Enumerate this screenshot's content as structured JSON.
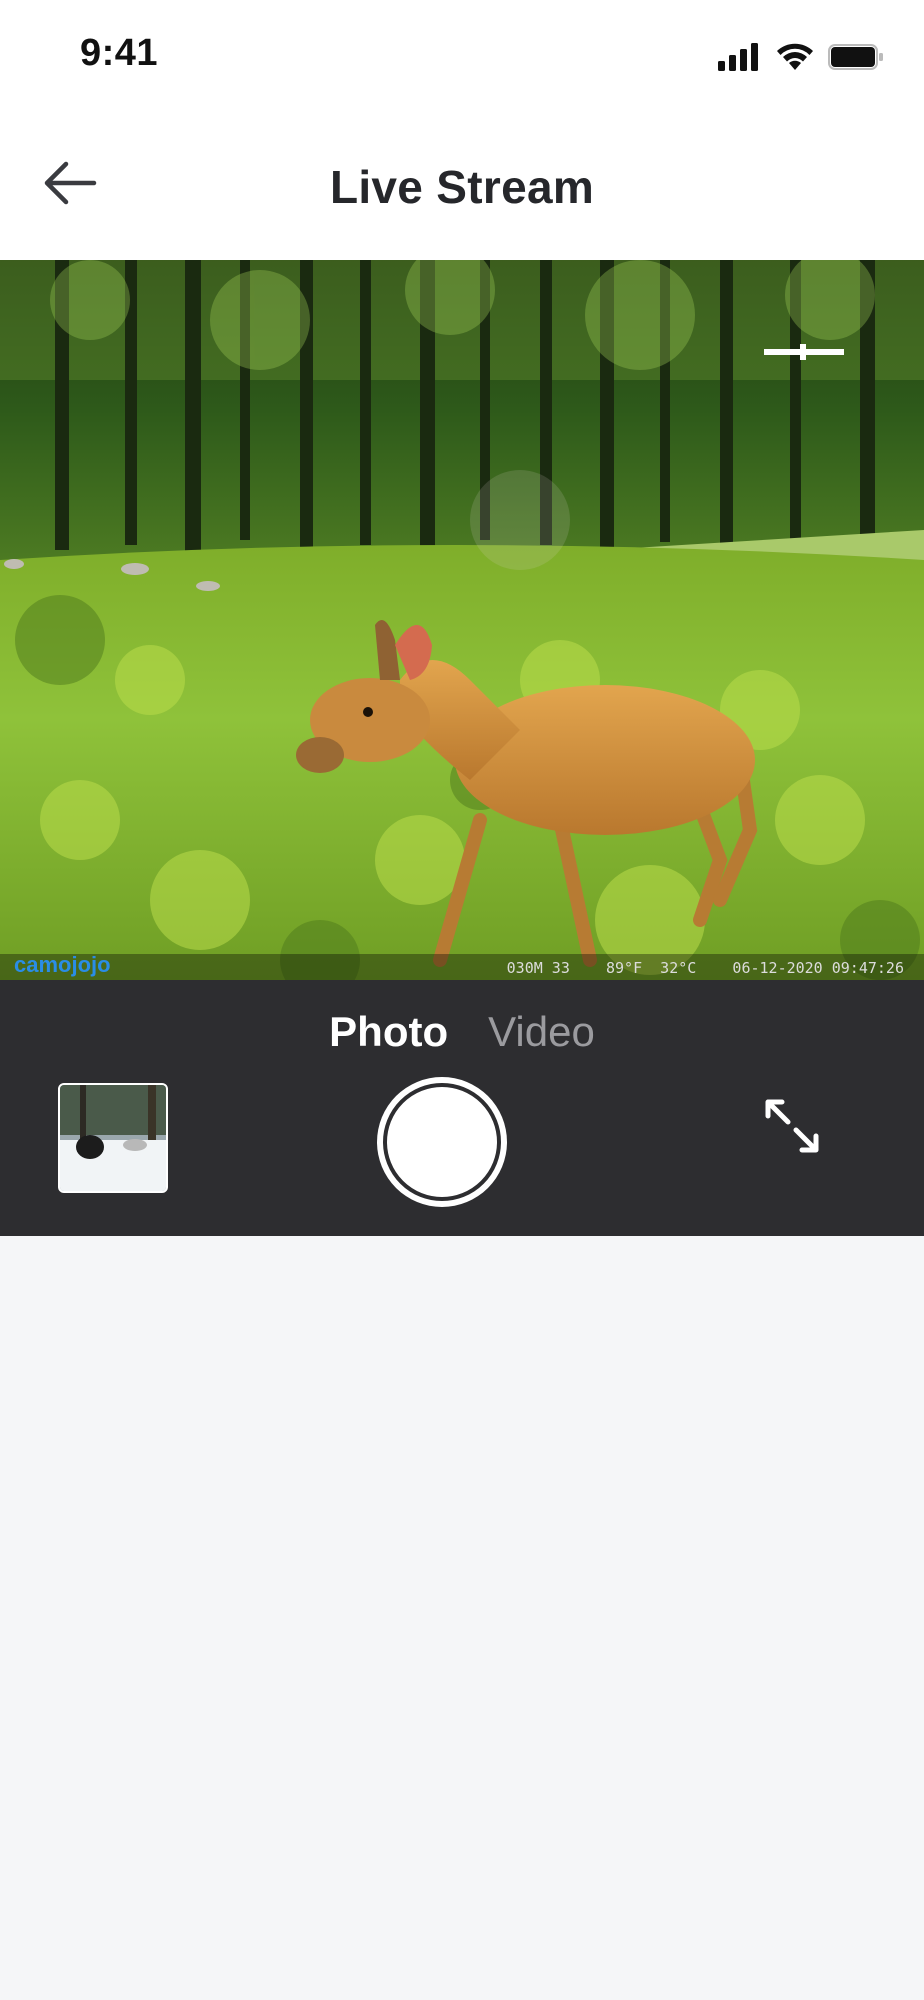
{
  "status_bar": {
    "time": "9:41"
  },
  "header": {
    "title": "Live Stream"
  },
  "live_view": {
    "brand": "camojojo",
    "info": "030M 33    89°F  32°C    06-12-2020 09:47:26"
  },
  "controls": {
    "tabs": [
      {
        "label": "Photo",
        "active": true
      },
      {
        "label": "Video",
        "active": false
      }
    ]
  },
  "colors": {
    "controls_background": "#2d2d30",
    "brand": "#2a8de6",
    "page_background": "#f5f6f8"
  },
  "icons": {
    "back": "arrow-left-icon",
    "fullscreen": "expand-icon",
    "signal": "signal-icon",
    "wifi": "wifi-icon",
    "battery": "battery-icon"
  }
}
